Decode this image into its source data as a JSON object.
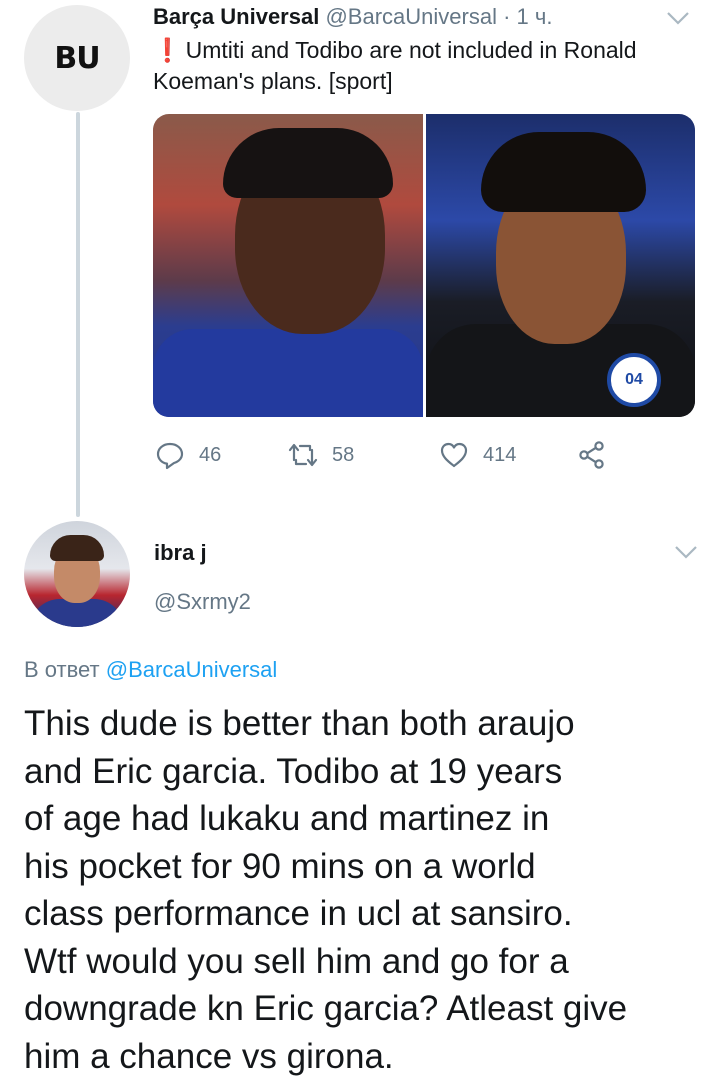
{
  "tweet1": {
    "avatar_text": "BU",
    "author_name": "Barça Universal",
    "author_handle": "@BarcaUniversal",
    "separator": "·",
    "time": "1 ч.",
    "alert_glyph": "❗",
    "text": "Umtiti and Todibo are not included in Ronald Koeman's plans. [sport]",
    "media_badge_text": "04",
    "actions": {
      "replies": "46",
      "retweets": "58",
      "likes": "414"
    }
  },
  "tweet2": {
    "author_name": "ibra j",
    "author_handle": "@Sxrmy2",
    "reply_prefix": "В ответ",
    "reply_mention": "@BarcaUniversal",
    "text_lines": [
      "This dude is better than both araujo",
      "and Eric garcia. Todibo at 19 years",
      "of age had lukaku and martinez in",
      "his pocket for 90 mins on a world",
      "class performance in ucl at sansiro.",
      "Wtf would you sell him and go for a",
      "downgrade kn Eric garcia? Atleast give",
      "him a chance vs girona."
    ]
  },
  "colors": {
    "text_primary": "#14171a",
    "text_secondary": "#657786",
    "link": "#1da1f2",
    "alert": "#e0245e",
    "thread_line": "#ccd6dd"
  },
  "icons": [
    "reply-icon",
    "retweet-icon",
    "like-icon",
    "share-icon",
    "chevron-down-icon"
  ]
}
